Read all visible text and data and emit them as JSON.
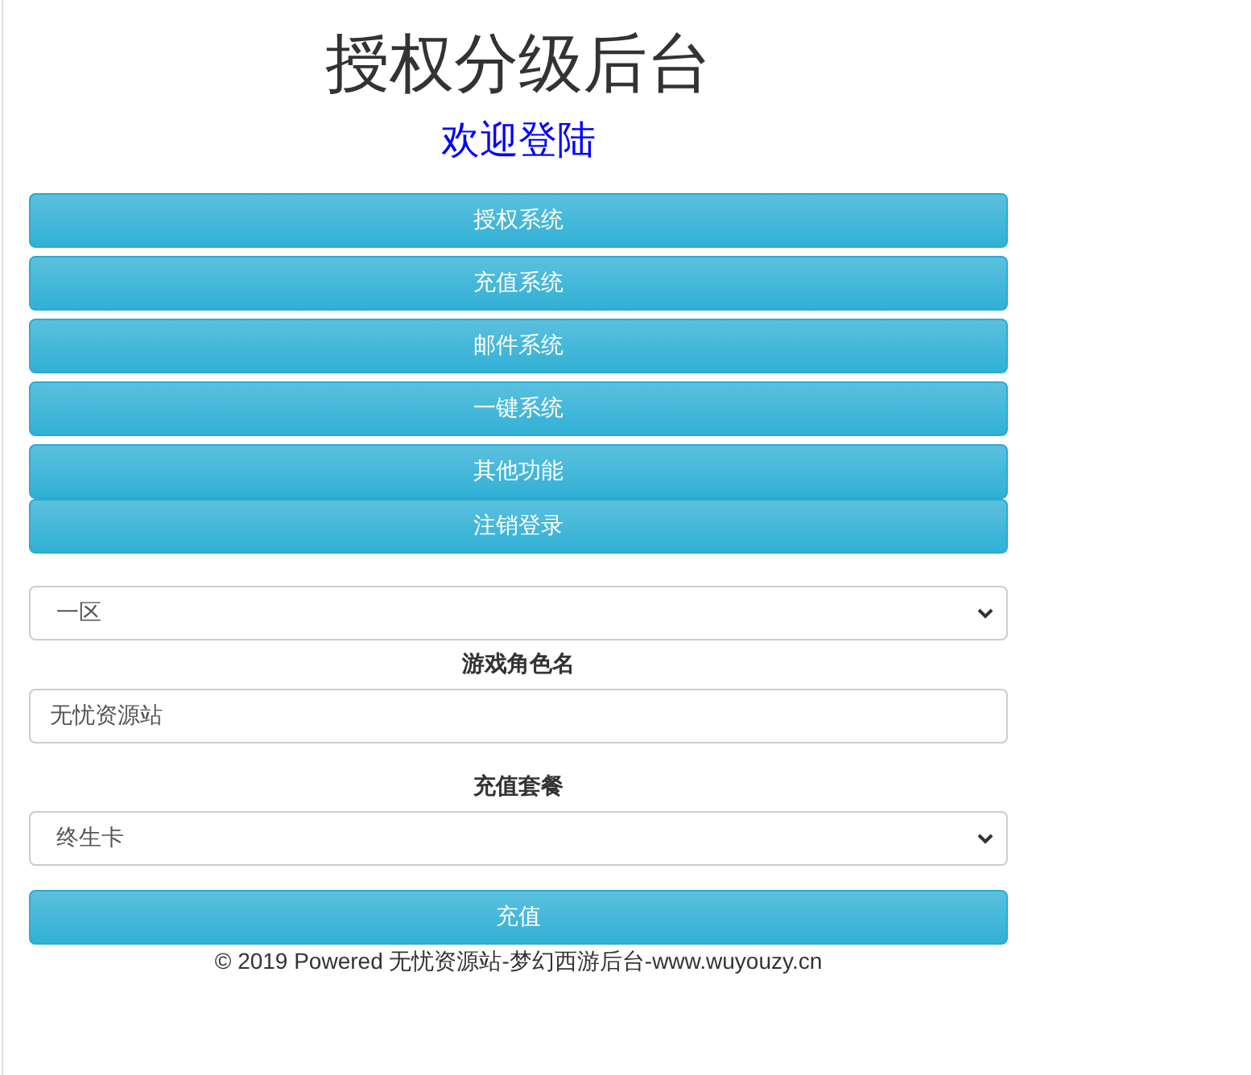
{
  "title": "授权分级后台",
  "subtitle": "欢迎登陆",
  "menu": [
    "授权系统",
    "充值系统",
    "邮件系统",
    "一键系统",
    "其他功能"
  ],
  "logout": "注销登录",
  "form": {
    "server": {
      "value": "一区"
    },
    "role_label": "游戏角色名",
    "role": {
      "value": "无忧资源站"
    },
    "package_label": "充值套餐",
    "package": {
      "value": "终生卡"
    },
    "submit": "充值"
  },
  "footer": "© 2019 Powered 无忧资源站-梦幻西游后台-www.wuyouzy.cn"
}
